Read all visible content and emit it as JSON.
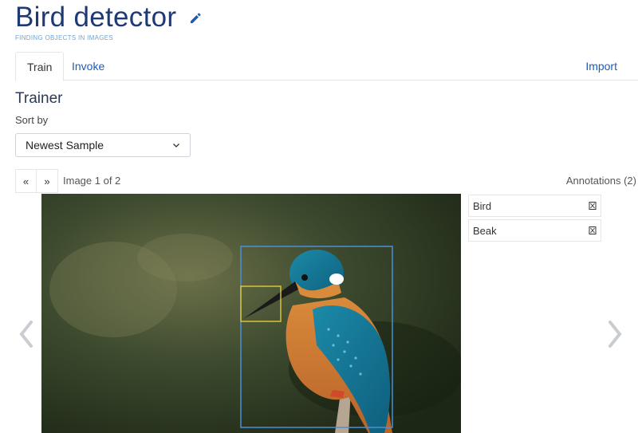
{
  "header": {
    "title": "Bird detector",
    "subtitle": "FINDING OBJECTS IN IMAGES",
    "edit_icon": "pencil-icon"
  },
  "tabs": {
    "train": "Train",
    "invoke": "Invoke",
    "import": "Import"
  },
  "trainer": {
    "title": "Trainer",
    "sort_label": "Sort by",
    "sort_value": "Newest Sample",
    "sort_options": [
      "Newest Sample"
    ]
  },
  "pager": {
    "first": "«",
    "next": "»",
    "status": "Image 1 of 2"
  },
  "annotations": {
    "header": "Annotations (2)",
    "items": [
      {
        "label": "Bird",
        "delete_icon": "delete-icon"
      },
      {
        "label": "Beak",
        "delete_icon": "delete-icon"
      }
    ]
  },
  "colors": {
    "title": "#1f3a73",
    "link": "#1f5bb5",
    "bird_box": "#4a90d6",
    "beak_box": "#d8c33a"
  }
}
